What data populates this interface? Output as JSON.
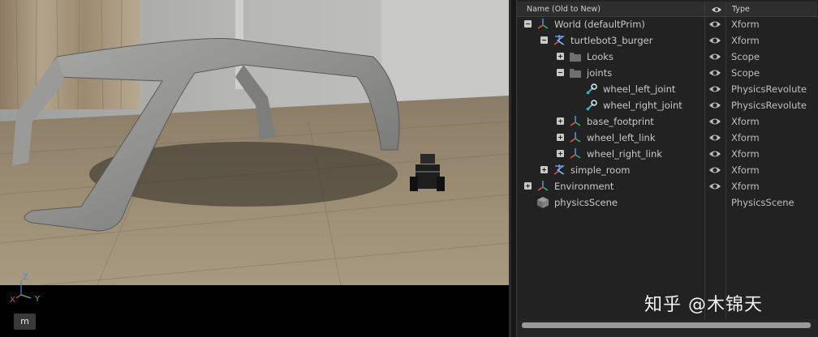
{
  "viewport": {
    "axis": {
      "z": "Z",
      "x": "X",
      "y": "Y"
    },
    "mode_button": "m"
  },
  "stage": {
    "header": {
      "name": "Name (Old to New)",
      "type": "Type"
    },
    "rows": [
      {
        "label": "World (defaultPrim)",
        "type": "Xform",
        "icon": "xform-icon",
        "toggle": "minus",
        "eye": true
      },
      {
        "label": "turtlebot3_burger",
        "type": "Xform",
        "icon": "articulation-icon",
        "toggle": "minus",
        "eye": true
      },
      {
        "label": "Looks",
        "type": "Scope",
        "icon": "folder-icon",
        "toggle": "plus",
        "eye": true
      },
      {
        "label": "joints",
        "type": "Scope",
        "icon": "folder-icon",
        "toggle": "minus",
        "eye": true
      },
      {
        "label": "wheel_left_joint",
        "type": "PhysicsRevolute",
        "icon": "revolute-joint-icon",
        "toggle": "none",
        "eye": true
      },
      {
        "label": "wheel_right_joint",
        "type": "PhysicsRevolute",
        "icon": "revolute-joint-icon",
        "toggle": "none",
        "eye": true
      },
      {
        "label": "base_footprint",
        "type": "Xform",
        "icon": "xform-icon",
        "toggle": "plus",
        "eye": true
      },
      {
        "label": "wheel_left_link",
        "type": "Xform",
        "icon": "xform-icon",
        "toggle": "plus",
        "eye": true
      },
      {
        "label": "wheel_right_link",
        "type": "Xform",
        "icon": "xform-icon",
        "toggle": "plus",
        "eye": true
      },
      {
        "label": "simple_room",
        "type": "Xform",
        "icon": "articulation-icon",
        "toggle": "plus",
        "eye": true
      },
      {
        "label": "Environment",
        "type": "Xform",
        "icon": "xform-icon",
        "toggle": "plus",
        "eye": true
      },
      {
        "label": "physicsScene",
        "type": "PhysicsScene",
        "icon": "cube-icon",
        "toggle": "none",
        "eye": false
      }
    ]
  },
  "watermark": "知乎 @木锦天",
  "colors": {
    "accent_cyan": "#33b5c8",
    "panel_bg": "#222222",
    "header_bg": "#2e2e2e"
  }
}
